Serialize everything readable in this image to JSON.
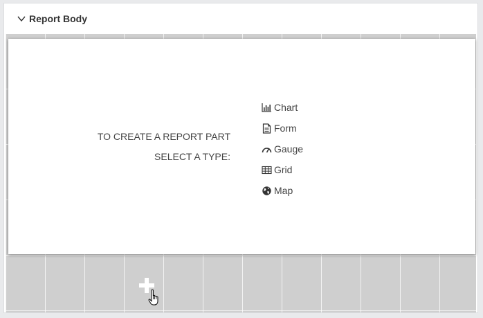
{
  "section": {
    "title": "Report Body",
    "expanded": true
  },
  "empty_part": {
    "prompt_line1": "TO CREATE A REPORT PART",
    "prompt_line2": "SELECT A TYPE:",
    "types": [
      {
        "label": "Chart",
        "icon": "bar-chart-icon"
      },
      {
        "label": "Form",
        "icon": "document-icon"
      },
      {
        "label": "Gauge",
        "icon": "gauge-icon"
      },
      {
        "label": "Grid",
        "icon": "table-grid-icon"
      },
      {
        "label": "Map",
        "icon": "globe-icon"
      }
    ]
  },
  "add_button": {
    "icon": "plus-icon"
  },
  "colors": {
    "background": "#e9eaec",
    "grid": "#cfcfcf",
    "text": "#444444"
  }
}
